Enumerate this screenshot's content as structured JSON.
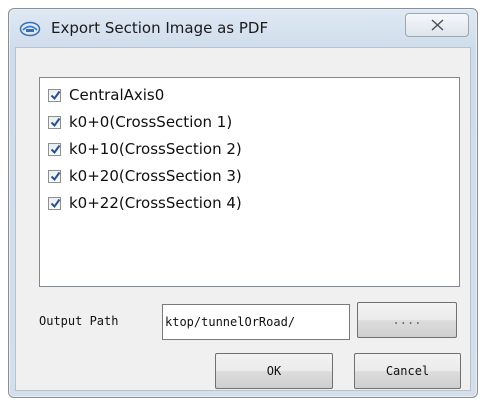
{
  "window": {
    "title": "Export Section Image as PDF"
  },
  "icons": {
    "app": "app-logo-icon",
    "close": "close-icon",
    "check": "checkmark-icon"
  },
  "layers": [
    {
      "label": "CentralAxis0",
      "checked": true
    },
    {
      "label": "k0+0(CrossSection 1)",
      "checked": true
    },
    {
      "label": "k0+10(CrossSection 2)",
      "checked": true
    },
    {
      "label": "k0+20(CrossSection 3)",
      "checked": true
    },
    {
      "label": "k0+22(CrossSection 4)",
      "checked": true
    }
  ],
  "output": {
    "label": "Output Path",
    "value": "ktop/tunnelOrRoad/",
    "browse_label": "...."
  },
  "buttons": {
    "ok": "OK",
    "cancel": "Cancel"
  },
  "colors": {
    "check": "#2b4f8a",
    "frame": "#d4dfec"
  }
}
